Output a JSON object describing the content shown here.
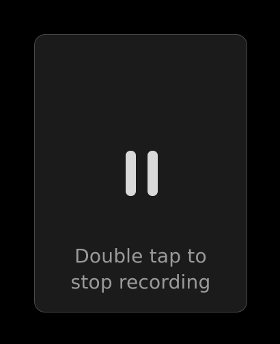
{
  "recording_card": {
    "hint_line_1": "Double tap to",
    "hint_line_2": "stop recording",
    "control_icon": "pause-icon"
  },
  "colors": {
    "background": "#000000",
    "card": "#1b1b1b",
    "card_border": "#4a4a4a",
    "icon": "#d9d9d9",
    "hint_text": "#9a9a9a"
  }
}
